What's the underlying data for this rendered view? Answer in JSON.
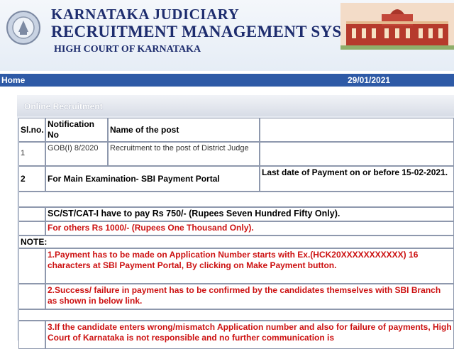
{
  "header": {
    "title_line1": "KARNATAKA JUDICIARY",
    "title_line2": "RECRUITMENT MANAGEMENT SYSTEM",
    "title_line3": "HIGH COURT OF KARNATAKA",
    "logo_icon": "karnataka-emblem-icon",
    "building_image": "high-court-building-icon"
  },
  "nav": {
    "home_label": "Home",
    "date": "29/01/2021"
  },
  "panel": {
    "title": "Online Recruitment"
  },
  "table": {
    "headers": {
      "slno": "Sl.no.",
      "notification": "Notification No",
      "post": "Name of the post"
    },
    "row1": {
      "slno": "1",
      "notification": "GOB(I) 8/2020",
      "post": "Recruitment to the post of District Judge"
    },
    "row2": {
      "slno": "2",
      "label": "For Main Examination- SBI Payment Portal",
      "last_date": "Last date of Payment on or before 15-02-2021."
    },
    "fee_sc": "SC/ST/CAT-I have to pay Rs 750/- (Rupees Seven Hundred Fifty Only).",
    "fee_others": "For others Rs 1000/- (Rupees One Thousand Only).",
    "note_label": "NOTE:",
    "note1": "1.Payment has to be made on Application Number starts with Ex.(HCK20XXXXXXXXXXX) 16 characters at SBI Payment Portal, By clicking on Make Payment button.",
    "note2": "2.Success/ failure in payment has to be confirmed by the candidates themselves with SBI Branch as shown in below link.",
    "note3": "3.If the candidate enters wrong/mismatch Application number and also for failure of payments, High Court of Karnataka is not responsible and no further communication is"
  },
  "colors": {
    "navy": "#1e2d6e",
    "nav_bar": "#2e5aa6",
    "alert_red": "#cc1111"
  }
}
